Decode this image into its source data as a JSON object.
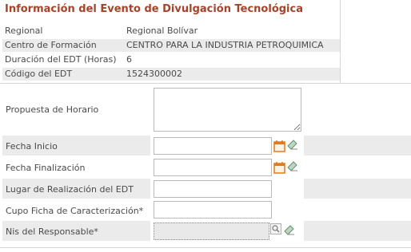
{
  "header": {
    "title": "Información del Evento de Divulgación Tecnológica"
  },
  "info": [
    {
      "label": "Regional",
      "value": "Regional Bolívar"
    },
    {
      "label": "Centro de Formación",
      "value": "CENTRO PARA LA INDUSTRIA PETROQUIMICA"
    },
    {
      "label": "Duración del EDT (Horas)",
      "value": "6"
    },
    {
      "label": "Código del EDT",
      "value": "1524300002"
    }
  ],
  "form": {
    "propuesta_horario": {
      "label": "Propuesta de Horario",
      "value": ""
    },
    "fecha_inicio": {
      "label": "Fecha Inicio",
      "value": ""
    },
    "fecha_finalizacion": {
      "label": "Fecha Finalización",
      "value": ""
    },
    "lugar": {
      "label": "Lugar de Realización del EDT",
      "value": ""
    },
    "cupo": {
      "label": "Cupo Ficha de Caracterización*",
      "value": ""
    },
    "nis": {
      "label": "Nis del Responsable*",
      "value": ""
    }
  },
  "icons": {
    "calendar": "calendar-icon",
    "clear": "eraser-icon",
    "search": "search-icon"
  },
  "colors": {
    "title": "#a5432a",
    "row_shade": "#ebebeb",
    "calendar": "#e07a1f"
  }
}
